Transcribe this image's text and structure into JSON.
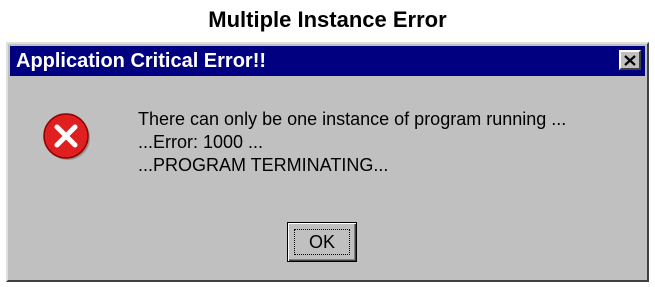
{
  "caption": "Multiple Instance Error",
  "dialog": {
    "title": "Application Critical Error!!",
    "close_icon": "close-icon",
    "icon": "error-icon",
    "message_lines": [
      "There can only be one instance of program running ...",
      "...Error: 1000 ...",
      "...PROGRAM TERMINATING..."
    ],
    "ok_label": "OK"
  },
  "colors": {
    "titlebar": "#000080",
    "dialog_bg": "#c0c0c0",
    "error_red": "#e02020"
  }
}
